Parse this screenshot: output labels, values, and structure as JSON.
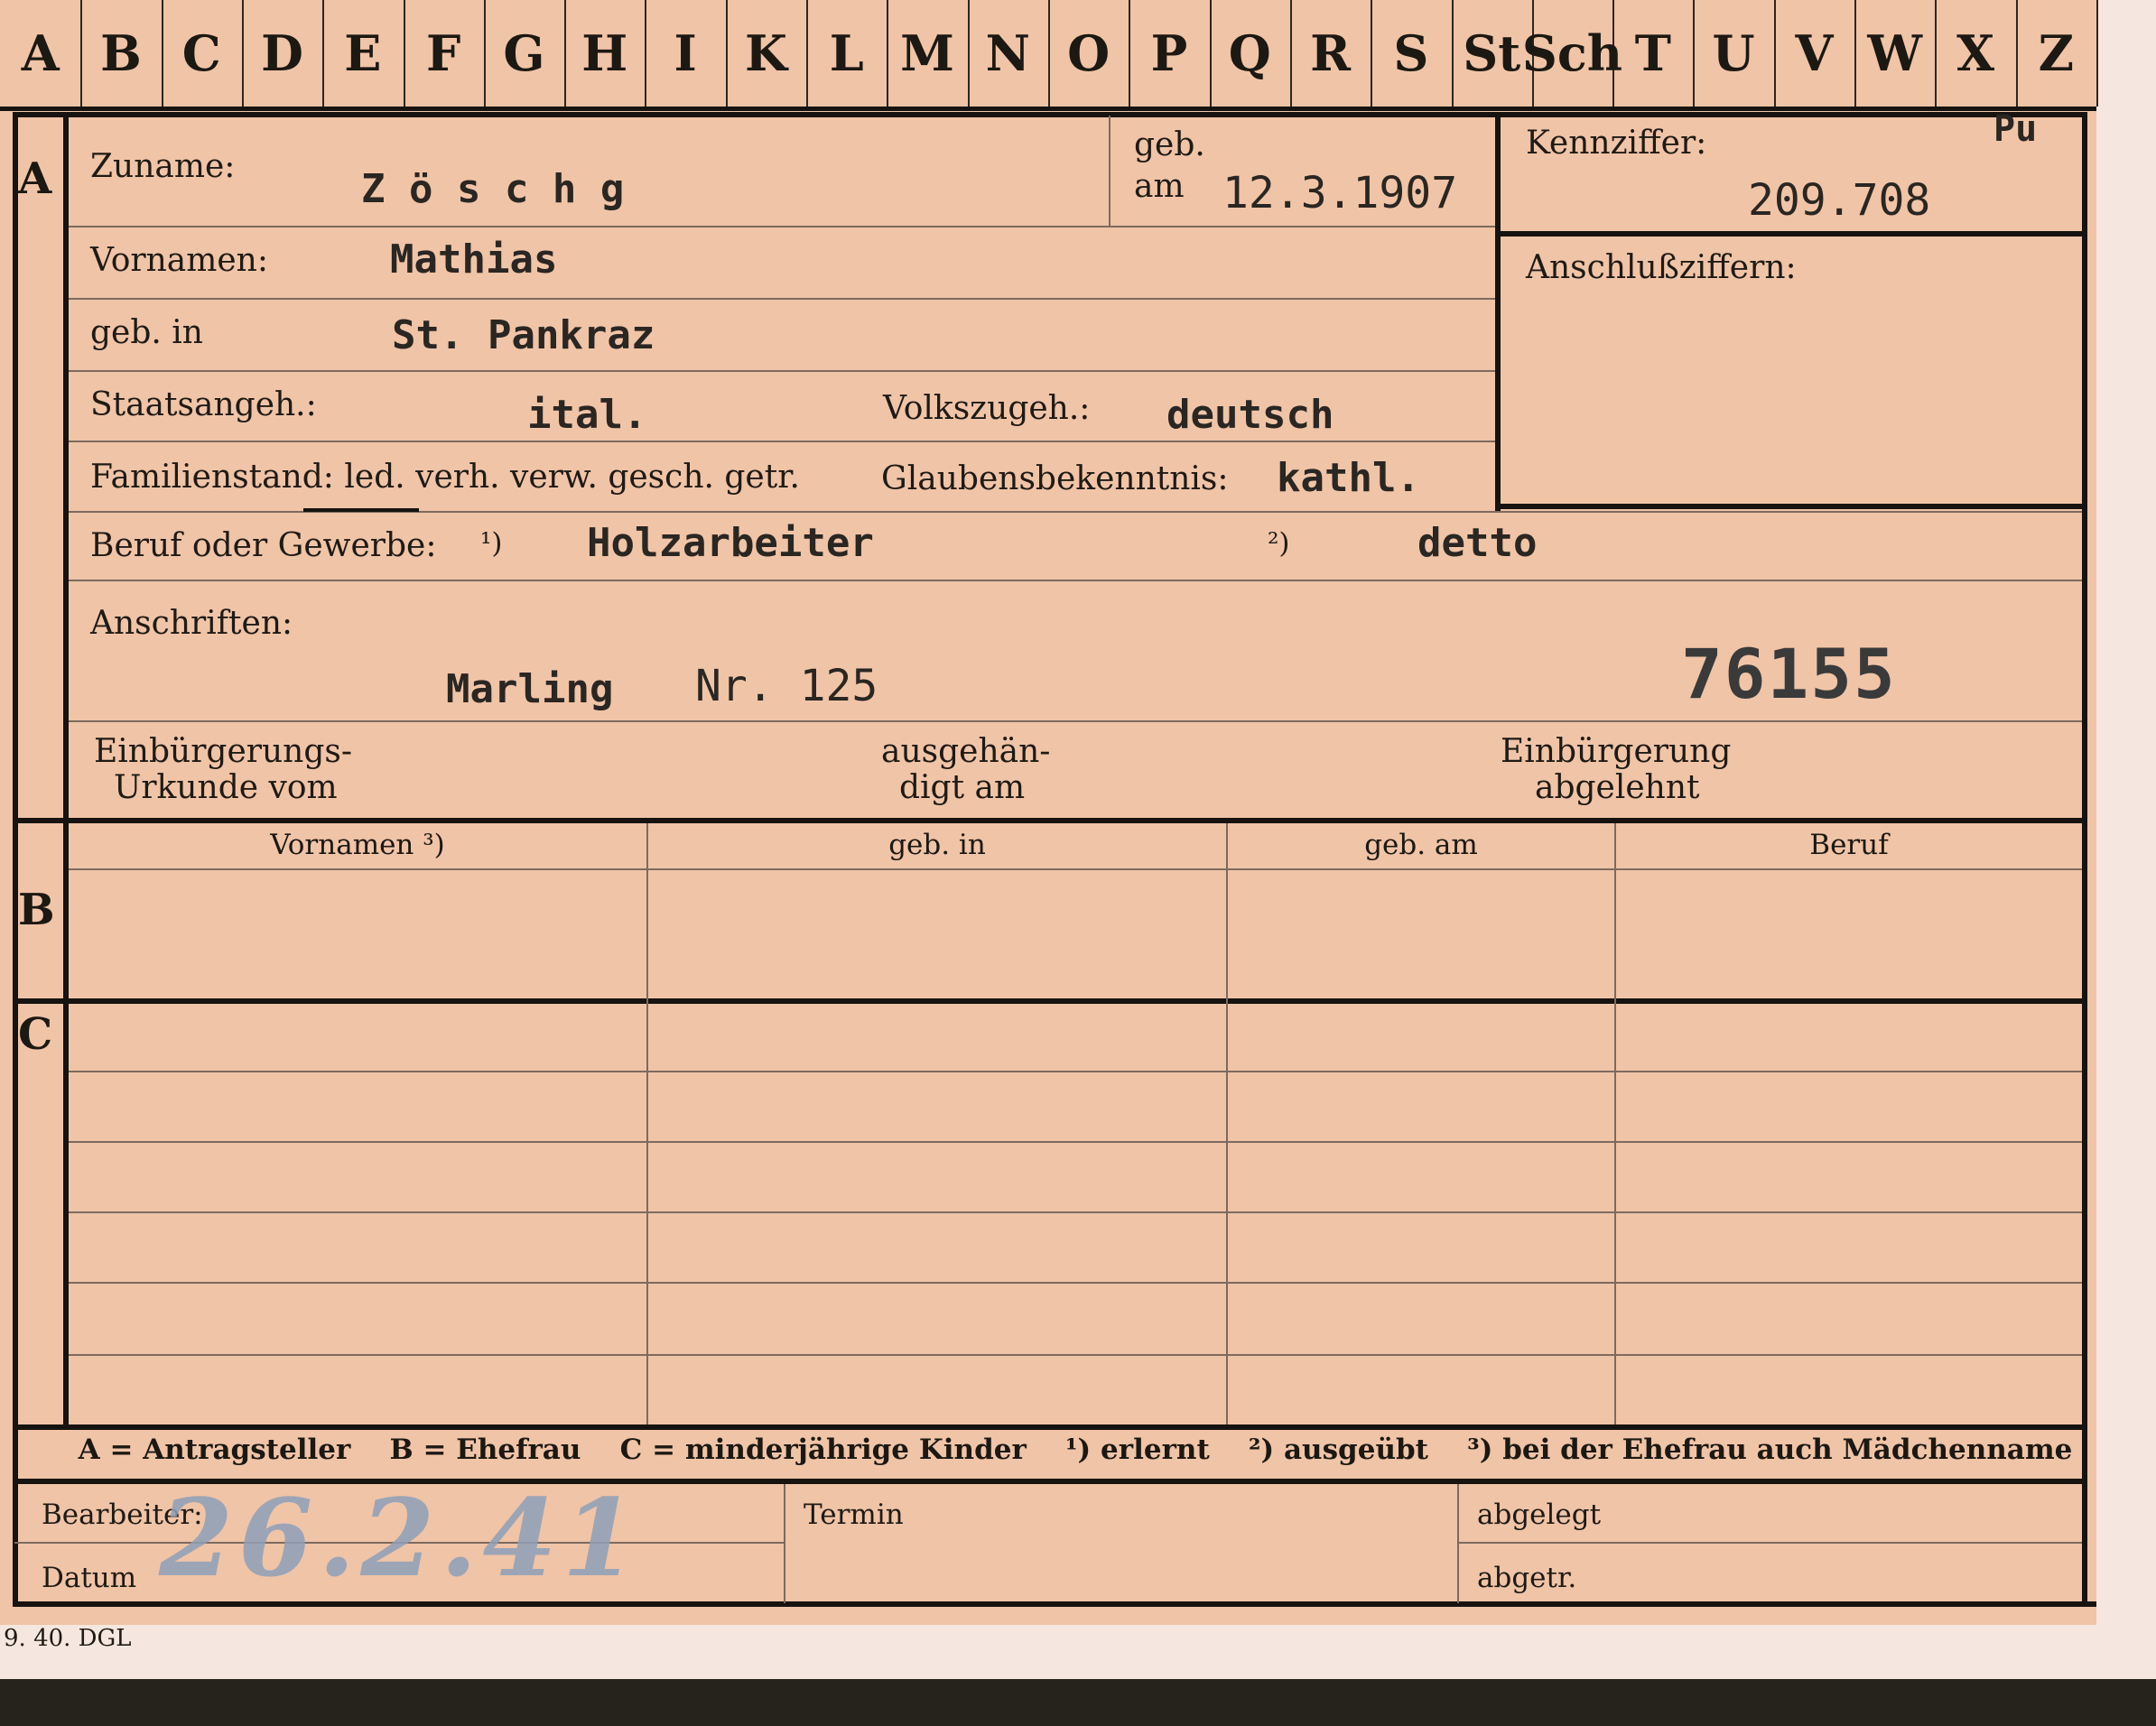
{
  "tabs": [
    "A",
    "B",
    "C",
    "D",
    "E",
    "F",
    "G",
    "H",
    "I",
    "K",
    "L",
    "M",
    "N",
    "O",
    "P",
    "Q",
    "R",
    "S",
    "St",
    "Sch",
    "T",
    "U",
    "V",
    "W",
    "X",
    "Z"
  ],
  "sections": {
    "a": "A",
    "b": "B",
    "c": "C"
  },
  "fields": {
    "surname_label": "Zuname:",
    "surname_value": "Z ö s c h g",
    "born_label_1": "geb.",
    "born_label_2": "am",
    "born_value": "12.3.1907",
    "file_no_label": "Kennziffer:",
    "file_no_mark": "Pu",
    "file_no_value": "209.708",
    "connection_label": "Anschlußziffern:",
    "firstname_label": "Vornamen:",
    "firstname_value": "Mathias",
    "birthplace_label": "geb. in",
    "birthplace_value": "St. Pankraz",
    "citizenship_label": "Staatsangeh.:",
    "citizenship_value": "ital.",
    "ethnicity_label": "Volkszugeh.:",
    "ethnicity_value": "deutsch",
    "marital_label": "Familienstand: led. verh. verw. gesch. getr.",
    "religion_label": "Glaubensbekenntnis:",
    "religion_value": "kathl.",
    "occupation_label": "Beruf oder Gewerbe:",
    "occ_note1": "¹)",
    "occ_value1": "Holzarbeiter",
    "occ_note2": "²)",
    "occ_value2": "detto",
    "address_label": "Anschriften:",
    "address_value": "Marling",
    "address_nr": "Nr. 125",
    "stamp_number": "76155",
    "naturalization_label_1": "Einbürgerungs-",
    "naturalization_label_2": "Urkunde vom",
    "handed_label_1": "ausgehän-",
    "handed_label_2": "digt am",
    "rejected_label_1": "Einbürgerung",
    "rejected_label_2": "abgelehnt"
  },
  "table_headers": [
    "Vornamen ³)",
    "geb. in",
    "geb. am",
    "Beruf"
  ],
  "legend": "A = Antragsteller    B = Ehefrau    C = minderjährige Kinder    ¹) erlernt    ²) ausgeübt    ³) bei der Ehefrau auch Mädchenname",
  "footer": {
    "clerk_label": "Bearbeiter:",
    "date_label": "Datum",
    "date_value": "26.2.41",
    "term_label": "Termin",
    "filed_label": "abgelegt",
    "sep_label": "abgetr.",
    "print_code": "9. 40. DGL"
  }
}
